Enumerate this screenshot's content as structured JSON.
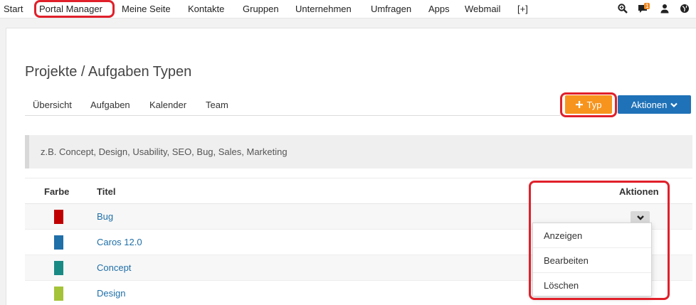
{
  "topnav": {
    "items": [
      "Start",
      "Portal Manager",
      "Meine Seite",
      "Kontakte",
      "Gruppen",
      "Unternehmen",
      "Umfragen",
      "Apps",
      "Webmail",
      "[+]"
    ],
    "icons": [
      "search-icon",
      "chat-icon",
      "user-icon",
      "globe-icon"
    ],
    "chat_badge": "1"
  },
  "page": {
    "title": "Projekte / Aufgaben Typen",
    "tabs": [
      "Übersicht",
      "Aufgaben",
      "Kalender",
      "Team"
    ],
    "add_type_button": "Typ",
    "actions_button": "Aktionen",
    "hint": "z.B. Concept, Design, Usability, SEO, Bug, Sales, Marketing"
  },
  "table": {
    "headers": {
      "color": "Farbe",
      "title": "Titel",
      "actions": "Aktionen"
    },
    "rows": [
      {
        "title": "Bug",
        "color": "#c00000"
      },
      {
        "title": "Caros 12.0",
        "color": "#1f6fa8"
      },
      {
        "title": "Concept",
        "color": "#1a8a85"
      },
      {
        "title": "Design",
        "color": "#a4c339"
      }
    ]
  },
  "dropdown": {
    "items": [
      "Anzeigen",
      "Bearbeiten",
      "Löschen"
    ]
  },
  "colors": {
    "accent_orange": "#f7941d",
    "accent_blue": "#1f72b8",
    "link": "#1f6fa8",
    "highlight": "#e0202a"
  }
}
